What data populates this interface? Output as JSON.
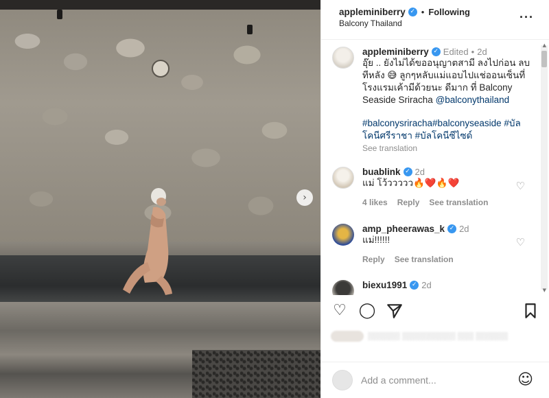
{
  "post": {
    "username": "appleminiberry",
    "location": "Balcony Thailand",
    "following_label": "Following",
    "more_icon": "more-horizontal-icon"
  },
  "caption": {
    "username": "appleminiberry",
    "edited_label": "Edited",
    "time": "2d",
    "text_line1": "อุ๊ย .. ยังไม่ได้ขออนุญาตสามี ลงไปก่อน ลบ",
    "text_line2": "ทีหลัง 😅 ลูกๆหลับแม่แอบไปแช่ออนเซ็นที่",
    "text_line3": "โรงแรมเค้ามีด้วยนะ ดีมาก ที่ Balcony",
    "text_line4": "Seaside Sriracha ",
    "mention": "@balconythailand",
    "tags_line1": "#balconysriracha#balconyseaside #บัล",
    "tags_line2": "โคนีศรีราชา #บัลโคนีซีไซด์",
    "see_translation": "See translation"
  },
  "comments": [
    {
      "username": "buablink",
      "time": "2d",
      "text": "แม่ โว้ววววว🔥❤️🔥❤️",
      "likes": "4 likes",
      "reply": "Reply",
      "see_translation": "See translation"
    },
    {
      "username": "amp_pheerawas_k",
      "time": "2d",
      "text": "แม่!!!!!!",
      "reply": "Reply",
      "see_translation": "See translation"
    },
    {
      "username": "biexu1991",
      "time": "2d"
    }
  ],
  "add_comment": {
    "placeholder": "Add a comment..."
  },
  "colors": {
    "verified": "#3897f0",
    "link": "#00376b",
    "muted": "#8e8e8e"
  }
}
